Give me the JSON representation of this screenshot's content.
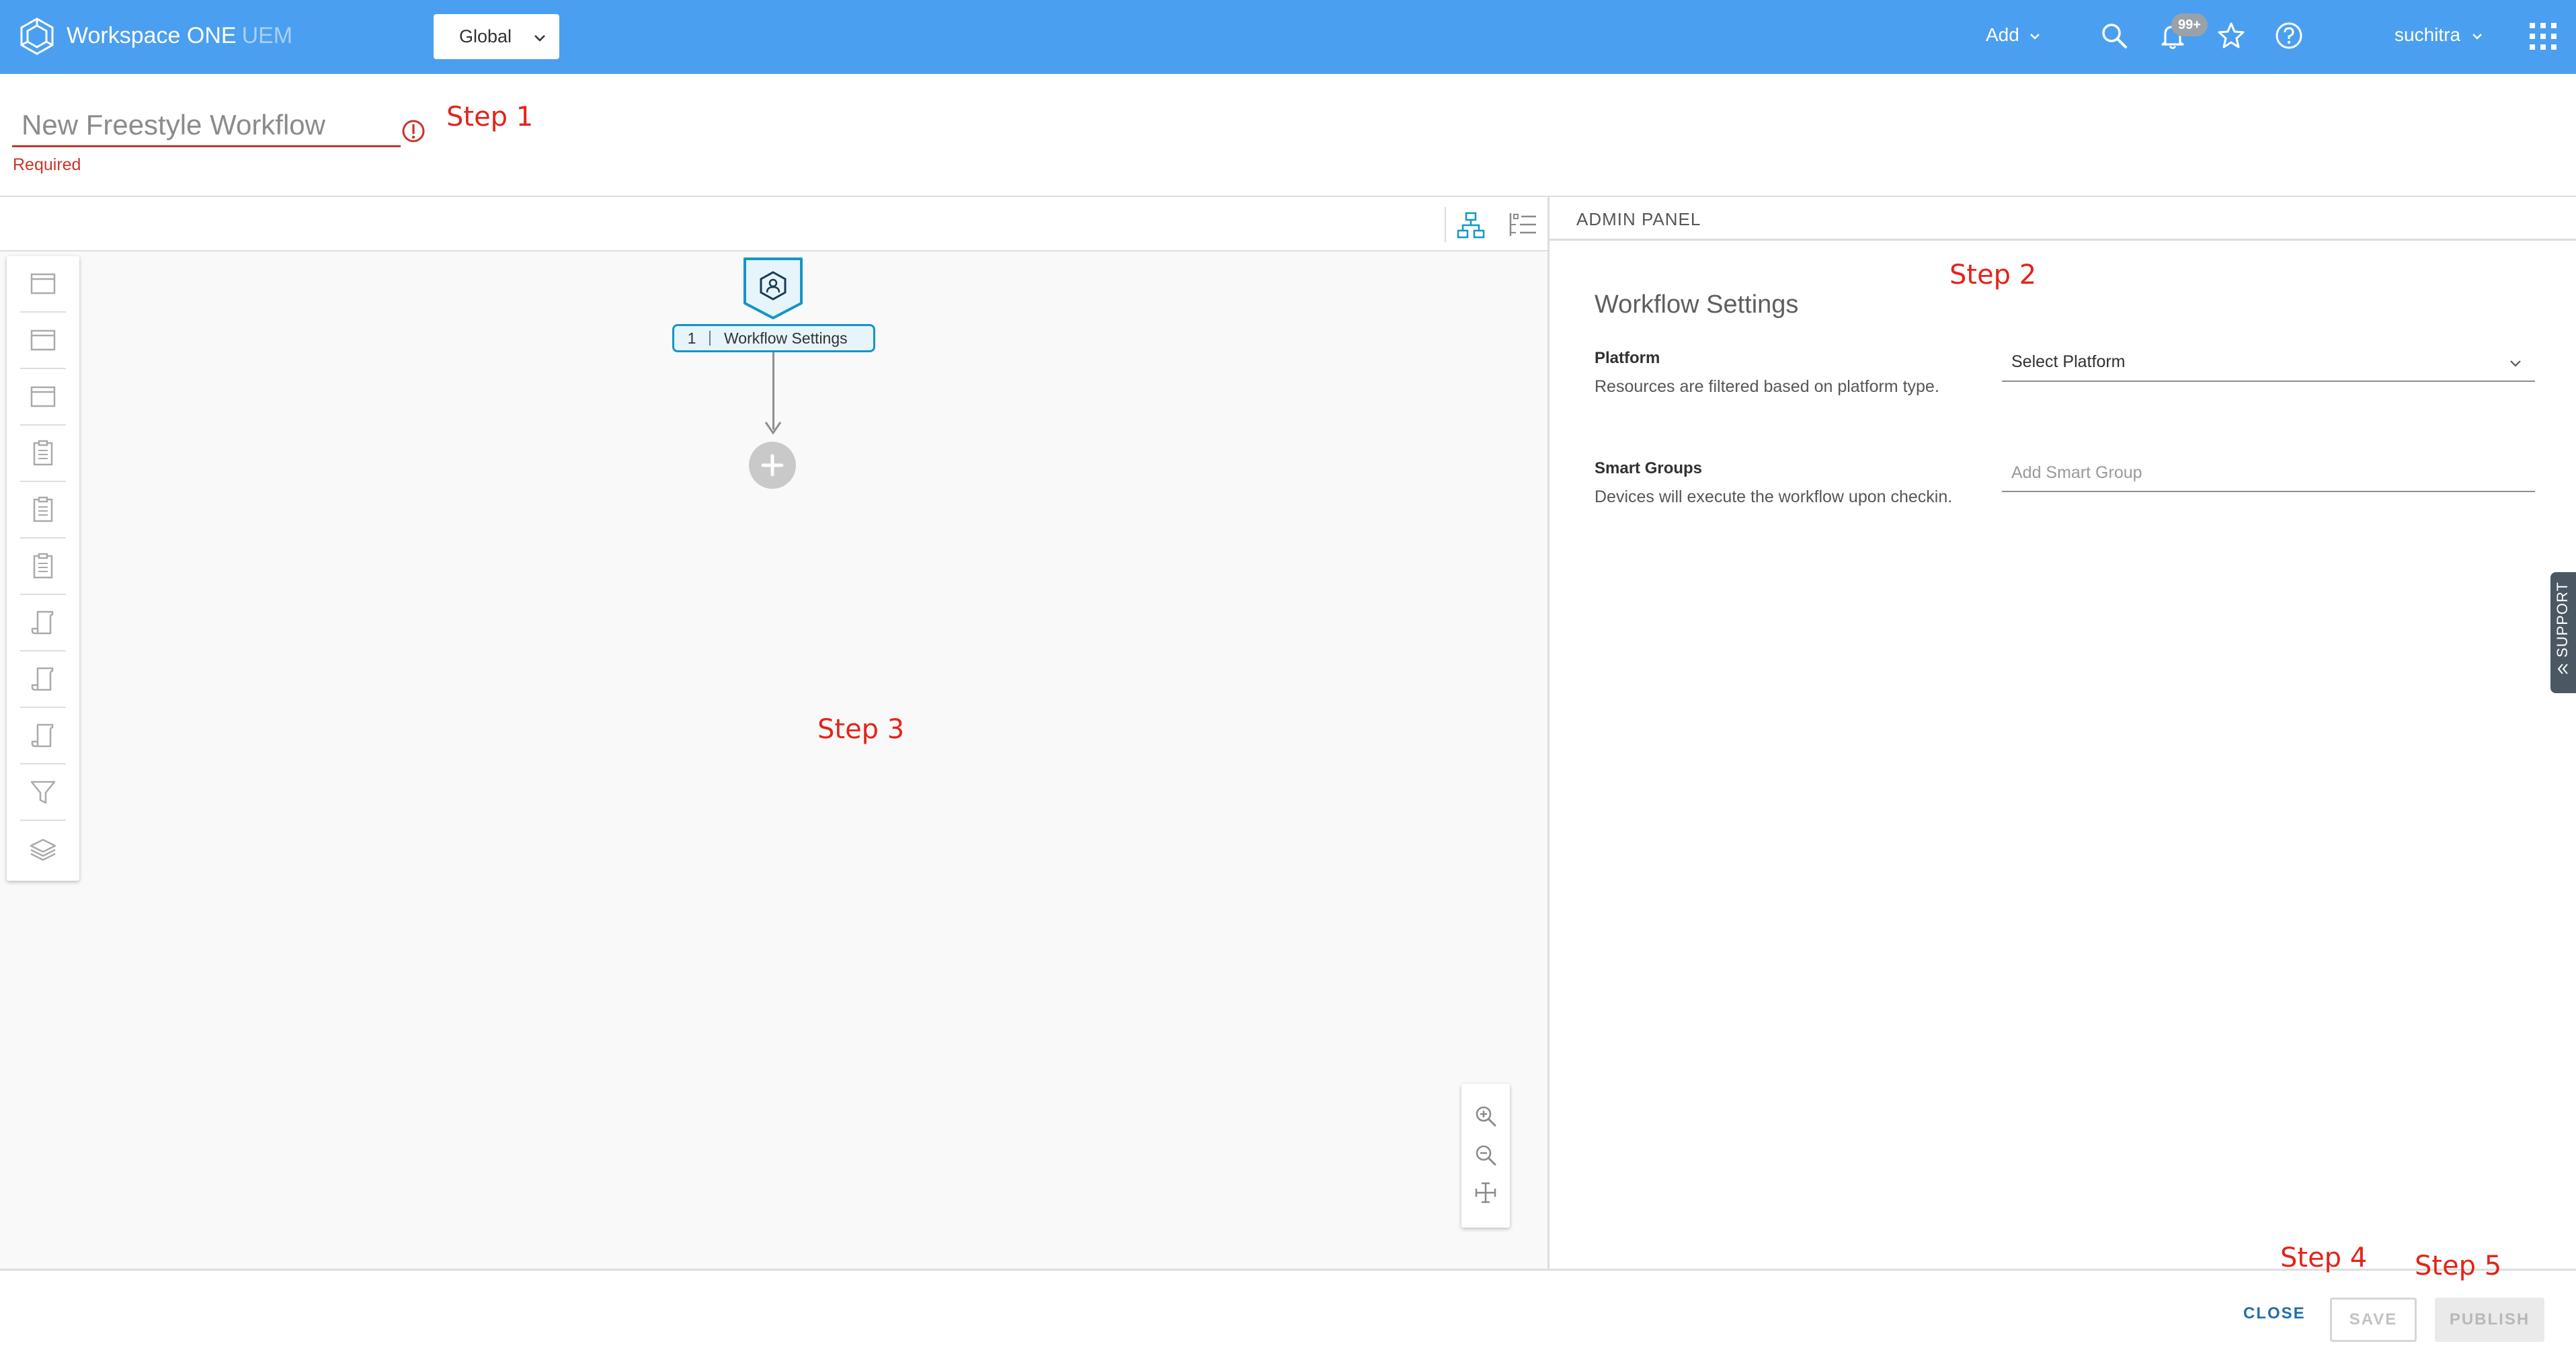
{
  "header": {
    "app_name": "Workspace ONE",
    "app_name_suffix": "UEM",
    "org_group": "Global",
    "add_menu_label": "Add",
    "notification_badge": "99+",
    "user_name": "suchitra",
    "brand_color": "#4a9ff0"
  },
  "title_area": {
    "workflow_name_placeholder": "New Freestyle Workflow",
    "validation_message": "Required",
    "error_color": "#c8352a"
  },
  "annotations": {
    "step1": "Step 1",
    "step2": "Step 2",
    "step3": "Step 3",
    "step4": "Step 4",
    "step5": "Step 5",
    "color": "#e3241b"
  },
  "canvas": {
    "view_buttons": [
      "hierarchy-icon",
      "list-icon"
    ],
    "palette_items": [
      "window-icon",
      "window-icon",
      "window-icon",
      "clipboard-icon",
      "clipboard-icon",
      "clipboard-icon",
      "script-icon",
      "script-icon",
      "script-icon",
      "filter-icon",
      "layers-icon"
    ],
    "node": {
      "number": "1",
      "label": "Workflow Settings",
      "accent_color": "#1595c7"
    },
    "zoom_buttons": [
      "zoom-in-icon",
      "zoom-out-icon",
      "fit-screen-icon"
    ]
  },
  "admin_panel": {
    "title": "ADMIN PANEL",
    "section_heading": "Workflow Settings",
    "platform": {
      "label": "Platform",
      "help": "Resources are filtered based on platform type.",
      "select_value": "Select Platform"
    },
    "smart_groups": {
      "label": "Smart Groups",
      "help": "Devices will execute the workflow upon checkin.",
      "placeholder": "Add Smart Group"
    },
    "support_tab": "SUPPORT"
  },
  "footer": {
    "close_label": "CLOSE",
    "save_label": "SAVE",
    "publish_label": "PUBLISH",
    "link_color": "#1f70a8"
  }
}
